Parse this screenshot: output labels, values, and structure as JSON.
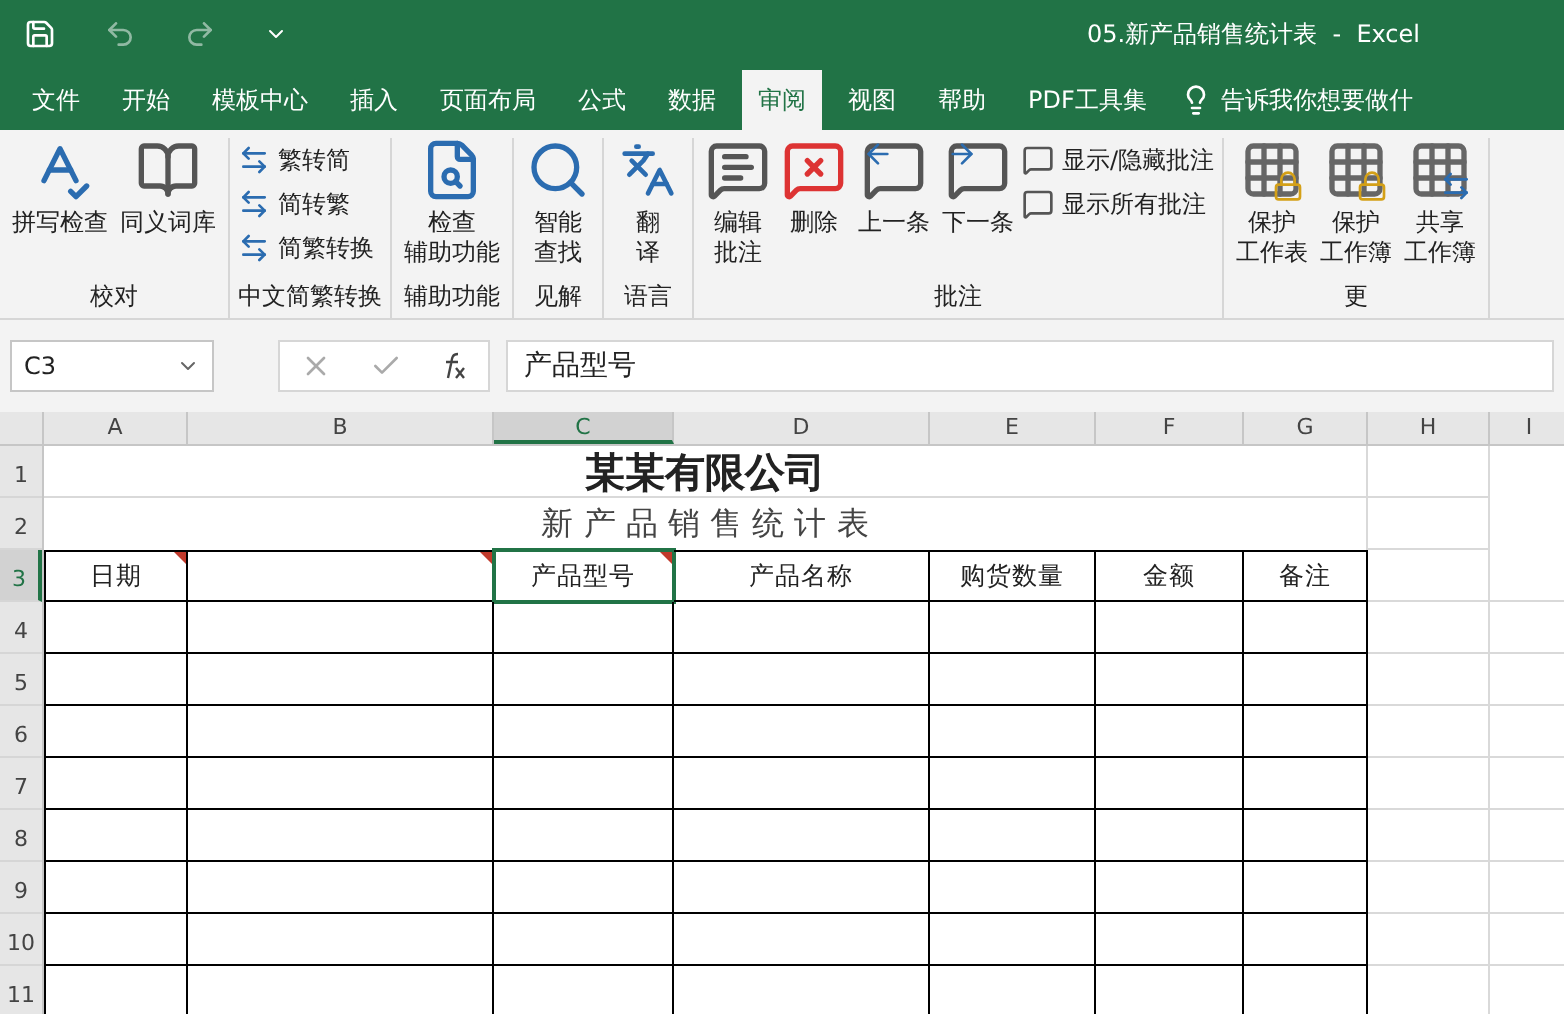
{
  "window": {
    "title": "05.新产品销售统计表  -  Excel"
  },
  "tabs": [
    {
      "label": "文件",
      "selected": false
    },
    {
      "label": "开始",
      "selected": false
    },
    {
      "label": "模板中心",
      "selected": false
    },
    {
      "label": "插入",
      "selected": false
    },
    {
      "label": "页面布局",
      "selected": false
    },
    {
      "label": "公式",
      "selected": false
    },
    {
      "label": "数据",
      "selected": false
    },
    {
      "label": "审阅",
      "selected": true
    },
    {
      "label": "视图",
      "selected": false
    },
    {
      "label": "帮助",
      "selected": false
    },
    {
      "label": "PDF工具集",
      "selected": false
    }
  ],
  "tell_me": "告诉我你想要做什",
  "ribbon": [
    {
      "label": "校对",
      "items": [
        {
          "kind": "large",
          "label": "拼写检查"
        },
        {
          "kind": "large",
          "label": "同义词库"
        }
      ]
    },
    {
      "label": "中文简繁转换",
      "items": [
        {
          "kind": "small",
          "label": "繁转简"
        },
        {
          "kind": "small",
          "label": "简转繁"
        },
        {
          "kind": "small",
          "label": "简繁转换"
        }
      ]
    },
    {
      "label": "辅助功能",
      "items": [
        {
          "kind": "large",
          "lines": [
            "检查",
            "辅助功能"
          ]
        }
      ]
    },
    {
      "label": "见解",
      "items": [
        {
          "kind": "large",
          "lines": [
            "智能",
            "查找"
          ]
        }
      ]
    },
    {
      "label": "语言",
      "items": [
        {
          "kind": "large",
          "lines": [
            "翻",
            "译"
          ]
        }
      ]
    },
    {
      "label": "批注",
      "items": [
        {
          "kind": "large",
          "lines": [
            "编辑",
            "批注"
          ]
        },
        {
          "kind": "large",
          "label": "删除"
        },
        {
          "kind": "large",
          "label": "上一条"
        },
        {
          "kind": "large",
          "label": "下一条"
        },
        {
          "kind": "small",
          "label": "显示/隐藏批注"
        },
        {
          "kind": "small",
          "label": "显示所有批注"
        }
      ]
    },
    {
      "label": "更",
      "items": [
        {
          "kind": "large",
          "lines": [
            "保护",
            "工作表"
          ]
        },
        {
          "kind": "large",
          "lines": [
            "保护",
            "工作簿"
          ]
        },
        {
          "kind": "large",
          "lines": [
            "共享",
            "工作簿"
          ]
        }
      ]
    }
  ],
  "name_box": "C3",
  "formula": "产品型号",
  "columns": [
    {
      "label": "A",
      "selected": false
    },
    {
      "label": "B",
      "selected": false
    },
    {
      "label": "C",
      "selected": true
    },
    {
      "label": "D",
      "selected": false
    },
    {
      "label": "E",
      "selected": false
    },
    {
      "label": "F",
      "selected": false
    },
    {
      "label": "G",
      "selected": false
    },
    {
      "label": "H",
      "selected": false
    },
    {
      "label": "I",
      "selected": false
    }
  ],
  "rows": [
    {
      "label": "1",
      "selected": false
    },
    {
      "label": "2",
      "selected": false
    },
    {
      "label": "3",
      "selected": true
    },
    {
      "label": "4",
      "selected": false
    },
    {
      "label": "5",
      "selected": false
    },
    {
      "label": "6",
      "selected": false
    },
    {
      "label": "7",
      "selected": false
    },
    {
      "label": "8",
      "selected": false
    },
    {
      "label": "9",
      "selected": false
    },
    {
      "label": "10",
      "selected": false
    },
    {
      "label": "11",
      "selected": false
    }
  ],
  "sheet": {
    "title": "某某有限公司",
    "subtitle": "新 产 品 销 售 统 计 表",
    "headers": [
      {
        "text": "日期",
        "comment": true,
        "selected": false
      },
      {
        "comment": true,
        "selected": false
      },
      {
        "text": "产品型号",
        "comment": true,
        "selected": true
      },
      {
        "text": "产品名称",
        "comment": false,
        "selected": false
      },
      {
        "text": "购货数量",
        "comment": false,
        "selected": false
      },
      {
        "text": "金额",
        "comment": false,
        "selected": false
      },
      {
        "text": "备注",
        "comment": false,
        "selected": false
      }
    ]
  }
}
